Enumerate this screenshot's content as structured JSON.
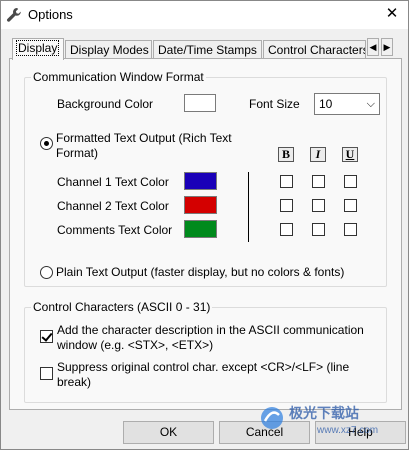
{
  "window": {
    "title": "Options",
    "close_glyph": "✕"
  },
  "tabs": [
    {
      "label": "Display",
      "active": true
    },
    {
      "label": "Display Modes",
      "active": false
    },
    {
      "label": "Date/Time Stamps",
      "active": false
    },
    {
      "label": "Control Characters",
      "active": false
    }
  ],
  "tab_scroll": {
    "left": "◀",
    "right": "▶"
  },
  "comm_format": {
    "title": "Communication Window Format",
    "background_color_label": "Background Color",
    "background_color": "#ffffff",
    "font_size_label": "Font Size",
    "font_size_value": "10",
    "formatted_text": {
      "label_line1": "Formatted Text Output (Rich Text",
      "label_line2": "Format)",
      "checked": true
    },
    "format_headers": [
      "B",
      "I",
      "U"
    ],
    "channels": [
      {
        "label": "Channel 1 Text Color",
        "color": "#1a00b8"
      },
      {
        "label": "Channel 2 Text Color",
        "color": "#d40000"
      },
      {
        "label": "Comments Text Color",
        "color": "#008a1c"
      }
    ],
    "plain_text": {
      "label": "Plain Text Output (faster display, but no colors & fonts)",
      "checked": false
    }
  },
  "control_chars": {
    "title": "Control Characters (ASCII 0 - 31)",
    "options": [
      {
        "line1": "Add the character description in the ASCII communication",
        "line2": "window (e.g. <STX>, <ETX>)",
        "checked": true
      },
      {
        "line1": "Suppress original control char. except <CR>/<LF> (line",
        "line2": "break)",
        "checked": false
      }
    ]
  },
  "buttons": {
    "ok": "OK",
    "cancel": "Cancel",
    "help": "Help"
  },
  "watermark": {
    "text1": "极光下载站",
    "text2": "www.xz7.com"
  }
}
